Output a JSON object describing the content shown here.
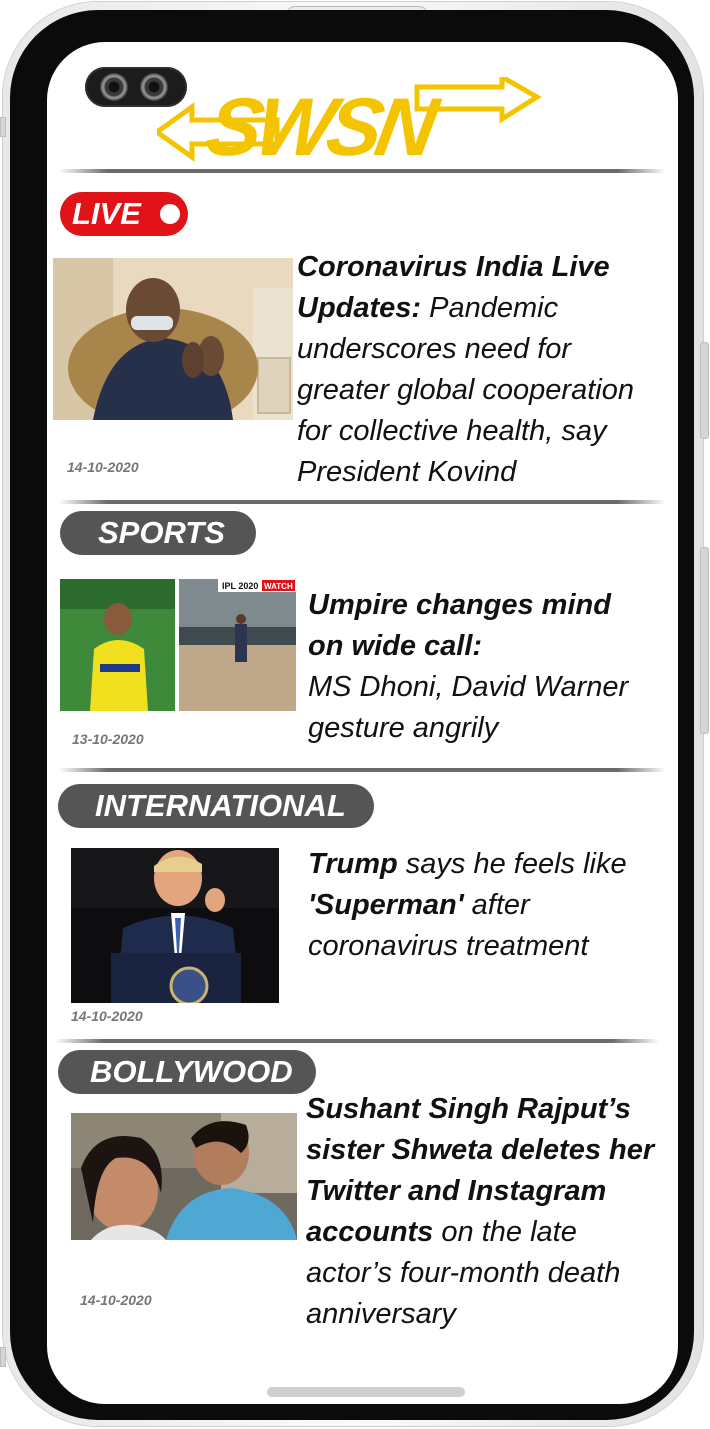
{
  "brand": {
    "name": "SWSN",
    "color": "#f5c400"
  },
  "live": {
    "label": "LIVE",
    "color": "#e21318"
  },
  "articles": [
    {
      "category": "LIVE",
      "date": "14-10-2020",
      "lines": [
        {
          "bold": "Coronavirus India Live",
          "rest": ""
        },
        {
          "bold": "Updates:",
          "rest": " Pandemic"
        },
        {
          "bold": "",
          "rest": " underscores need for"
        },
        {
          "bold": "",
          "rest": "greater global cooperation"
        },
        {
          "bold": "",
          "rest": " for collective health, say"
        },
        {
          "bold": "",
          "rest": " President Kovind"
        }
      ]
    },
    {
      "category": "SPORTS",
      "date": "13-10-2020",
      "thumb_label": "IPL 2020",
      "thumb_badge": "WATCH",
      "lines": [
        {
          "bold": "Umpire changes mind",
          "rest": ""
        },
        {
          "bold": "on wide call:",
          "rest": ""
        },
        {
          "bold": "",
          "rest": "MS Dhoni, David Warner"
        },
        {
          "bold": "",
          "rest": "gesture angrily"
        }
      ]
    },
    {
      "category": "INTERNATIONAL",
      "date": "14-10-2020",
      "lines": [
        {
          "bold": "Trump",
          "rest": " says he feels like"
        },
        {
          "bold": "'Superman'",
          "rest": " after"
        },
        {
          "bold": "",
          "rest": " coronavirus treatment"
        }
      ]
    },
    {
      "category": "BOLLYWOOD",
      "date": "14-10-2020",
      "lines": [
        {
          "bold": "Sushant Singh Rajput’s",
          "rest": ""
        },
        {
          "bold": "sister Shweta deletes her",
          "rest": ""
        },
        {
          "bold": "Twitter and Instagram",
          "rest": ""
        },
        {
          "bold": "accounts",
          "rest": " on the late"
        },
        {
          "bold": "",
          "rest": "actor’s four-month death"
        },
        {
          "bold": "",
          "rest": " anniversary"
        }
      ]
    }
  ]
}
